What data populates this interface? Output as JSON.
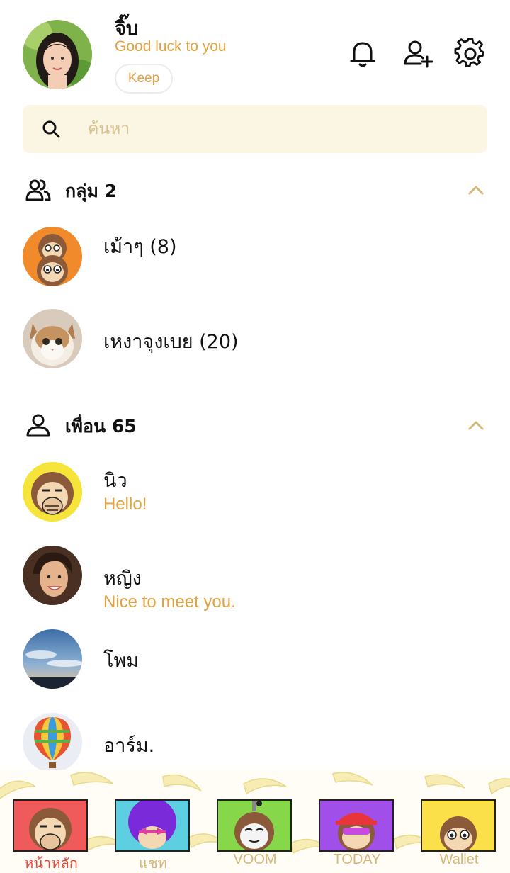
{
  "profile": {
    "name": "จิ๊บ",
    "status": "Good luck to you",
    "keep_label": "Keep"
  },
  "header_icons": [
    "bell-icon",
    "add-friend-icon",
    "settings-gear-icon"
  ],
  "search": {
    "placeholder": "ค้นหา",
    "value": ""
  },
  "groups_section": {
    "title": "กลุ่ม 2",
    "icon": "group-people-icon",
    "expanded": true
  },
  "groups": [
    {
      "name": "เม้าๆ (8)",
      "avatar": "monkey-stack"
    },
    {
      "name": "เหงาจุงเบย (20)",
      "avatar": "cat"
    }
  ],
  "friends_section": {
    "title": "เพื่อน 65",
    "icon": "person-icon",
    "expanded": true
  },
  "friends": [
    {
      "name": "นิว",
      "message": "Hello!",
      "avatar": "monkey-yellow"
    },
    {
      "name": "หญิง",
      "message": "Nice to meet you.",
      "avatar": "woman"
    },
    {
      "name": "โพม",
      "message": "",
      "avatar": "sky"
    },
    {
      "name": "อาร์ม.",
      "message": "",
      "avatar": "balloon"
    }
  ],
  "bottom_nav": [
    {
      "label": "หน้าหลัก",
      "active": true
    },
    {
      "label": "แชท",
      "active": false
    },
    {
      "label": "VOOM",
      "active": false
    },
    {
      "label": "TODAY",
      "active": false
    },
    {
      "label": "Wallet",
      "active": false
    }
  ],
  "colors": {
    "accent": "#e3a23f",
    "search_bg": "#fbf5e3",
    "active_tab": "#e8473a",
    "inactive_tab": "#d6b77a"
  }
}
